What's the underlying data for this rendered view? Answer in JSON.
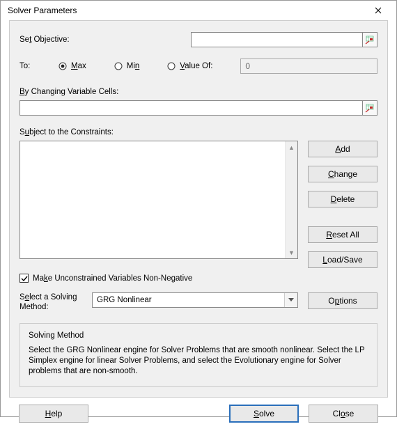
{
  "window": {
    "title": "Solver Parameters"
  },
  "objective": {
    "label_pre": "Se",
    "label_u": "t",
    "label_post": " Objective:",
    "value": ""
  },
  "to": {
    "label": "To:",
    "max_u": "M",
    "max_post": "ax",
    "min_pre": "Mi",
    "min_u": "n",
    "valueof_u": "V",
    "valueof_post": "alue Of:",
    "valueof_value": "0",
    "selected": "max"
  },
  "changing": {
    "label_u": "B",
    "label_post": "y Changing Variable Cells:",
    "value": ""
  },
  "constraints": {
    "label_pre": "S",
    "label_u": "u",
    "label_post": "bject to the Constraints:",
    "items": []
  },
  "buttons": {
    "add_u": "A",
    "add_post": "dd",
    "change_u": "C",
    "change_post": "hange",
    "delete_u": "D",
    "delete_post": "elete",
    "resetall_u": "R",
    "resetall_post": "eset All",
    "loadsave_u": "L",
    "loadsave_post": "oad/Save",
    "options_pre": "O",
    "options_u": "p",
    "options_post": "tions",
    "help_u": "H",
    "help_post": "elp",
    "solve_u": "S",
    "solve_post": "olve",
    "close_pre": "Cl",
    "close_u": "o",
    "close_post": "se"
  },
  "checkbox": {
    "checked": true,
    "label_pre": "Ma",
    "label_u": "k",
    "label_post": "e Unconstrained Variables Non-Negative"
  },
  "method": {
    "label_pre": "S",
    "label_u": "e",
    "label_post": "lect a Solving Method:",
    "value": "GRG Nonlinear"
  },
  "description": {
    "title": "Solving Method",
    "body": "Select the GRG Nonlinear engine for Solver Problems that are smooth nonlinear. Select the LP Simplex engine for linear Solver Problems, and select the Evolutionary engine for Solver problems that are non-smooth."
  }
}
